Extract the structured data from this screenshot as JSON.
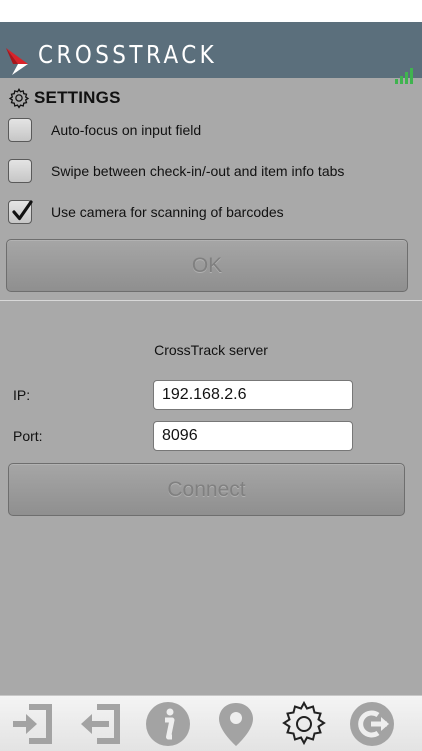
{
  "header": {
    "logo_text": "CROSSTRACK"
  },
  "settings": {
    "title": "SETTINGS",
    "options": [
      {
        "label": "Auto-focus on input field",
        "checked": false
      },
      {
        "label": "Swipe between check-in/-out and item info tabs",
        "checked": false
      },
      {
        "label": "Use camera for scanning of barcodes",
        "checked": true
      }
    ],
    "ok_label": "OK"
  },
  "server": {
    "title": "CrossTrack server",
    "ip_label": "IP:",
    "ip_value": "192.168.2.6",
    "port_label": "Port:",
    "port_value": "8096",
    "connect_label": "Connect"
  },
  "tabbar": {
    "icons": [
      "check-in-icon",
      "check-out-icon",
      "info-icon",
      "location-pin-icon",
      "settings-gear-icon",
      "logout-icon"
    ],
    "active": "settings-gear-icon"
  },
  "colors": {
    "header": "#5b6f7c",
    "background": "#a9a9a9",
    "accent_red": "#d8232a",
    "signal_green": "#3fb34f"
  }
}
